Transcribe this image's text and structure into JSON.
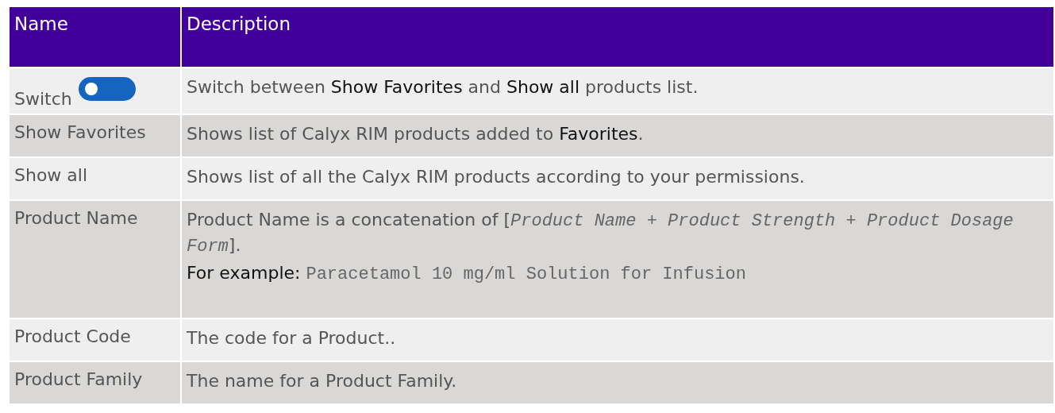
{
  "table": {
    "columns": [
      "Name",
      "Description"
    ],
    "rows": [
      {
        "name": "Switch",
        "switch": {
          "on": false
        },
        "paragraphs": [
          [
            {
              "kind": "plain",
              "text": "Switch between "
            },
            {
              "kind": "term",
              "text": "Show Favorites"
            },
            {
              "kind": "plain",
              "text": " and "
            },
            {
              "kind": "term",
              "text": "Show all"
            },
            {
              "kind": "plain",
              "text": " products list."
            }
          ]
        ]
      },
      {
        "name": "Show Favorites",
        "paragraphs": [
          [
            {
              "kind": "plain",
              "text": "Shows list of Calyx RIM products added to "
            },
            {
              "kind": "term",
              "text": "Favorites"
            },
            {
              "kind": "plain",
              "text": "."
            }
          ]
        ]
      },
      {
        "name": "Show all",
        "paragraphs": [
          [
            {
              "kind": "plain",
              "text": "Shows list of all the Calyx RIM products according to your permissions."
            }
          ]
        ]
      },
      {
        "name": "Product Name",
        "paragraphs": [
          [
            {
              "kind": "plain",
              "text": "Product Name is a concatenation of ["
            },
            {
              "kind": "code-italic",
              "text": "Product Name + Product Strength + Product Dosage Form"
            },
            {
              "kind": "plain",
              "text": "]."
            }
          ],
          [
            {
              "kind": "term",
              "text": "For example: "
            },
            {
              "kind": "code",
              "text": "Paracetamol 10 mg/ml Solution for Infusion"
            }
          ]
        ]
      },
      {
        "name": "Product Code",
        "paragraphs": [
          [
            {
              "kind": "plain",
              "text": "The code for a Product.."
            }
          ]
        ]
      },
      {
        "name": "Product Family",
        "paragraphs": [
          [
            {
              "kind": "plain",
              "text": "The name for a Product Family."
            }
          ]
        ]
      }
    ]
  }
}
